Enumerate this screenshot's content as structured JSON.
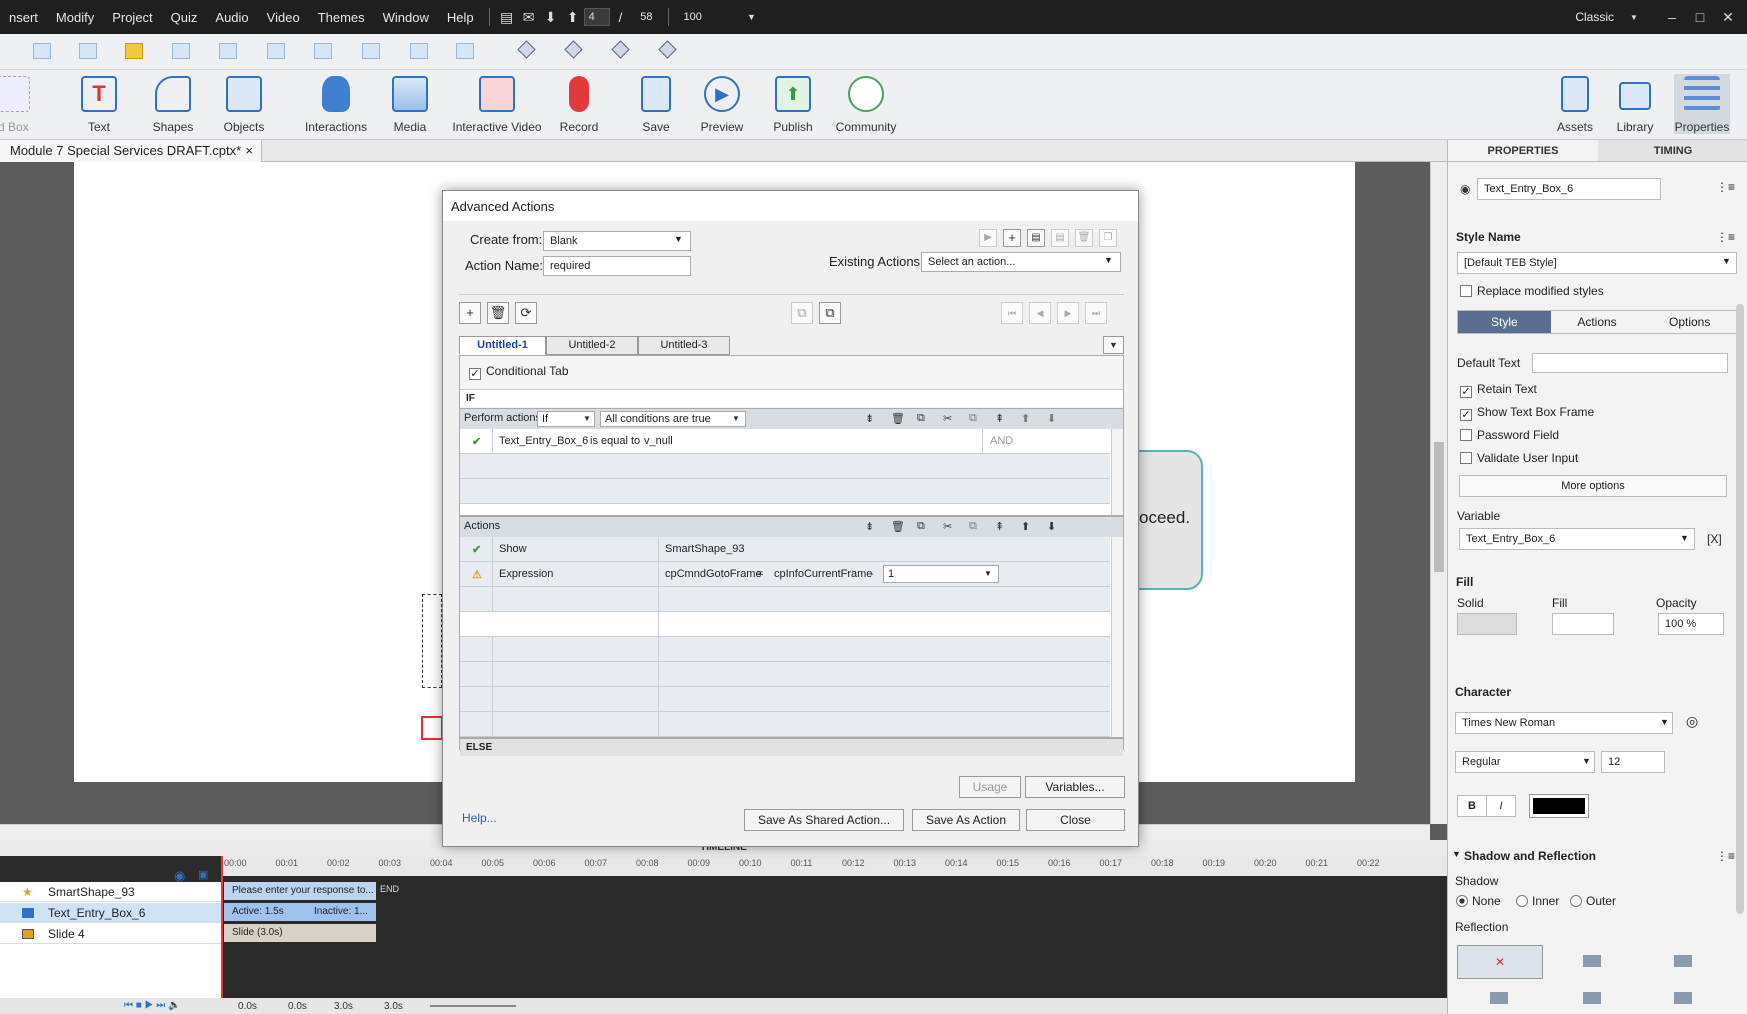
{
  "menu": {
    "items": [
      "nsert",
      "Modify",
      "Project",
      "Quiz",
      "Audio",
      "Video",
      "Themes",
      "Window",
      "Help"
    ],
    "slide_current": "4",
    "slide_sep": "/",
    "slide_total": "58",
    "zoom": "100",
    "workspace": "Classic"
  },
  "toolbar": {
    "items": [
      {
        "label": "id Box",
        "icon": "id-box-icon"
      },
      {
        "label": "Text",
        "icon": "text-icon"
      },
      {
        "label": "Shapes",
        "icon": "shapes-icon"
      },
      {
        "label": "Objects",
        "icon": "objects-icon"
      },
      {
        "label": "Interactions",
        "icon": "hand-pointer-icon"
      },
      {
        "label": "Media",
        "icon": "image-icon"
      },
      {
        "label": "Interactive Video",
        "icon": "video-icon"
      },
      {
        "label": "Record",
        "icon": "microphone-icon"
      },
      {
        "label": "Save",
        "icon": "floppy-icon"
      },
      {
        "label": "Preview",
        "icon": "play-icon"
      },
      {
        "label": "Publish",
        "icon": "publish-icon"
      },
      {
        "label": "Community",
        "icon": "community-icon"
      },
      {
        "label": "Assets",
        "icon": "assets-icon"
      },
      {
        "label": "Library",
        "icon": "folder-icon"
      },
      {
        "label": "Properties",
        "icon": "properties-icon"
      }
    ]
  },
  "document": {
    "tab_title": "Module 7 Special Services DRAFT.cptx*",
    "close": "×",
    "bubble_text": "oceed."
  },
  "dialog": {
    "title": "Advanced Actions",
    "create_from_label": "Create from:",
    "create_from_value": "Blank",
    "action_name_label": "Action Name:",
    "action_name_value": "required",
    "existing_actions_label": "Existing Actions:",
    "existing_actions_value": "Select an action...",
    "tabs": [
      "Untitled-1",
      "Untitled-2",
      "Untitled-3"
    ],
    "conditional_tab_label": "Conditional Tab",
    "if_label": "IF",
    "perform_actions_label": "Perform actions:",
    "perform_actions_value": "If",
    "conditions_value": "All conditions are true",
    "condition_row": {
      "variable": "Text_Entry_Box_6",
      "operator": "is equal to",
      "value": "v_null",
      "joiner": "AND"
    },
    "actions_label": "Actions",
    "action_rows": [
      {
        "action": "Show",
        "target": "SmartShape_93"
      },
      {
        "action": "Expression",
        "target": "cpCmndGotoFrame",
        "eq": "=",
        "operand": "cpInfoCurrentFrame",
        "op": "-",
        "value": "1"
      }
    ],
    "else_label": "ELSE",
    "usage_button": "Usage",
    "variables_button": "Variables...",
    "help_link": "Help...",
    "save_shared_button": "Save As Shared Action...",
    "save_action_button": "Save As Action",
    "close_button": "Close"
  },
  "timeline": {
    "title": "TIMELINE",
    "layers": [
      "SmartShape_93",
      "Text_Entry_Box_6",
      "Slide 4"
    ],
    "bars": [
      "Please enter your response to...",
      "Active: 1.5s",
      "Inactive: 1...",
      "Slide (3.0s)"
    ],
    "end_label": "END",
    "ticks": [
      "00:00",
      "00:01",
      "00:02",
      "00:03",
      "00:04",
      "00:05",
      "00:06",
      "00:07",
      "00:08",
      "00:09",
      "00:10",
      "00:11",
      "00:12",
      "00:13",
      "00:14",
      "00:15",
      "00:16",
      "00:17",
      "00:18",
      "00:19",
      "00:20",
      "00:21",
      "00:22"
    ],
    "footer": [
      "0.0s",
      "0.0s",
      "3.0s",
      "3.0s"
    ]
  },
  "properties": {
    "tabs": [
      "PROPERTIES",
      "TIMING"
    ],
    "object_name": "Text_Entry_Box_6",
    "style_name_label": "Style Name",
    "style_name_value": "[Default TEB Style]",
    "replace_modified_styles": "Replace modified styles",
    "subtabs": [
      "Style",
      "Actions",
      "Options"
    ],
    "default_text_label": "Default Text",
    "retain_text": "Retain Text",
    "show_text_box_frame": "Show Text Box Frame",
    "password_field": "Password Field",
    "validate_user_input": "Validate User Input",
    "more_options": "More options",
    "variable_label": "Variable",
    "variable_value": "Text_Entry_Box_6",
    "fill_section": "Fill",
    "solid_label": "Solid",
    "fill_label": "Fill",
    "opacity_label": "Opacity",
    "opacity_value": "100 %",
    "character_section": "Character",
    "font_value": "Times New Roman",
    "weight_value": "Regular",
    "size_value": "12",
    "bold": "B",
    "italic": "I",
    "shadow_section": "Shadow and Reflection",
    "shadow_label": "Shadow",
    "shadow_options": [
      "None",
      "Inner",
      "Outer"
    ],
    "reflection_label": "Reflection"
  }
}
